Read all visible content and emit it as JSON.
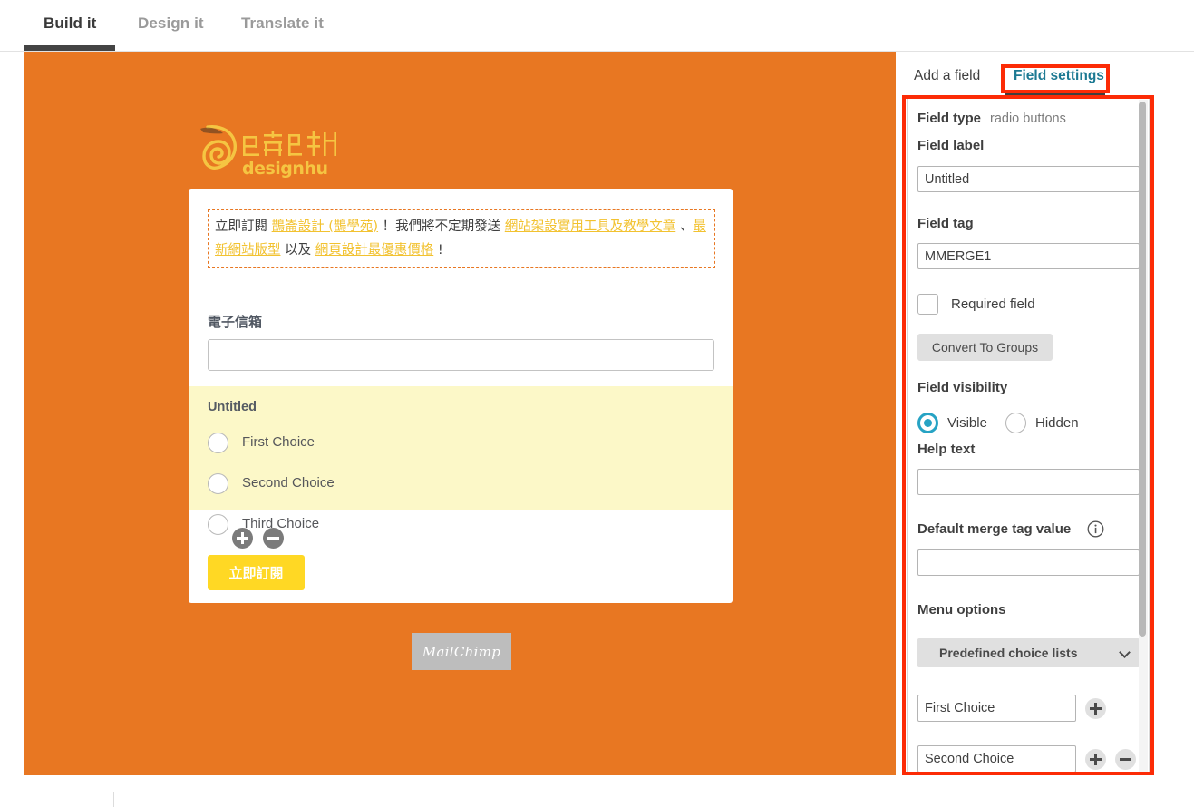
{
  "top_tabs": [
    {
      "label": "Build it",
      "active": true
    },
    {
      "label": "Design it",
      "active": false
    },
    {
      "label": "Translate it",
      "active": false
    }
  ],
  "colors": {
    "canvas_orange": "#e87722",
    "highlight_yellow": "#fcf8c8",
    "button_yellow": "#ffd824",
    "link_yellow": "#f2c230",
    "accent_teal": "#1d7a93",
    "radio_selected": "#27a3c4",
    "annotation_red": "#fc2b06",
    "mailchimp_gray": "#bdbdbd"
  },
  "preview": {
    "logo": {
      "icon_name": "designhu-bird-logo",
      "chinese_name": "鵲崙設計",
      "latin_name": "designhu"
    },
    "intro": {
      "segments": [
        {
          "text": "立即訂閱 ",
          "link": false
        },
        {
          "text": "鵲崙設計 (鵲學苑)",
          "link": true
        },
        {
          "text": " ！我們將不定期發送 ",
          "link": false
        },
        {
          "text": "網站架設實用工具及教學文章",
          "link": true
        },
        {
          "text": " 、",
          "link": false
        },
        {
          "text": "最新網站版型",
          "link": true
        },
        {
          "text": " 以及 ",
          "link": false
        },
        {
          "text": "網頁設計最優惠價格",
          "link": true
        },
        {
          "text": " !",
          "link": false
        }
      ]
    },
    "email": {
      "label": "電子信箱",
      "value": "",
      "placeholder": ""
    },
    "radio_group": {
      "title": "Untitled",
      "options": [
        {
          "label": "First Choice",
          "selected": false
        },
        {
          "label": "Second Choice",
          "selected": false
        },
        {
          "label": "Third Choice",
          "selected": false
        }
      ],
      "add_icon": "plus-circle-icon",
      "remove_icon": "minus-circle-icon"
    },
    "submit_button": {
      "label": "立即訂閱"
    },
    "mailchimp_badge": {
      "label": "MailChimp"
    }
  },
  "panel": {
    "tabs": [
      {
        "label": "Add a field",
        "active": false
      },
      {
        "label": "Field settings",
        "active": true
      }
    ],
    "field_type": {
      "label": "Field type",
      "value": "radio buttons"
    },
    "field_label": {
      "label": "Field label",
      "value": "Untitled",
      "placeholder": ""
    },
    "field_tag": {
      "label": "Field tag",
      "value": "MMERGE1",
      "placeholder": ""
    },
    "required_field": {
      "label": "Required field",
      "checked": false
    },
    "convert_button": {
      "label": "Convert To Groups"
    },
    "field_visibility": {
      "label": "Field visibility",
      "options": [
        {
          "label": "Visible",
          "selected": true
        },
        {
          "label": "Hidden",
          "selected": false
        }
      ]
    },
    "help_text": {
      "label": "Help text",
      "value": "",
      "placeholder": ""
    },
    "default_merge_tag": {
      "label": "Default merge tag value",
      "info_icon": "info-circle-icon",
      "value": "",
      "placeholder": ""
    },
    "menu_options": {
      "label": "Menu options",
      "select": {
        "value": "Predefined choice lists",
        "chevron_icon": "chevron-down-icon"
      },
      "choices": [
        {
          "value": "First Choice",
          "has_add": true,
          "has_remove": false
        },
        {
          "value": "Second Choice",
          "has_add": true,
          "has_remove": true
        }
      ],
      "add_icon": "plus-circle-icon",
      "remove_icon": "minus-circle-icon"
    }
  },
  "annotations": [
    {
      "name": "field-settings-tab-highlight"
    },
    {
      "name": "field-settings-panel-highlight"
    }
  ]
}
